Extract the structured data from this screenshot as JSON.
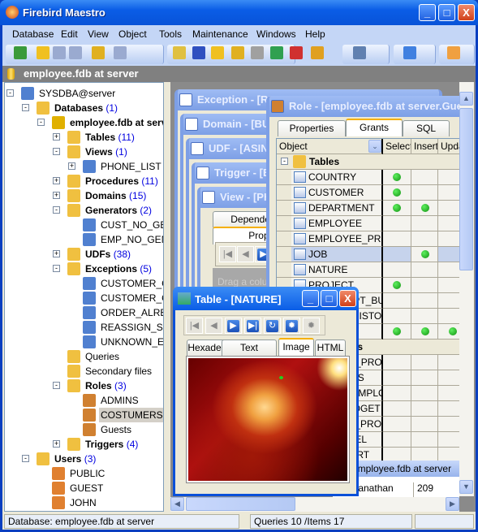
{
  "app": {
    "title": "Firebird Maestro",
    "icon": "firebird-logo-icon",
    "window_buttons": {
      "minimize": "_",
      "maximize": "□",
      "close": "X"
    }
  },
  "menu": [
    "Database",
    "Edit",
    "View",
    "Object",
    "Tools",
    "Maintenance",
    "Windows",
    "Help"
  ],
  "toolbar_icons": [
    "refresh-icon",
    "create-database-icon",
    "register-database-icon",
    "unregister-database-icon",
    "connect-icon",
    "disconnect-icon",
    "new-object-icon",
    "design-icon",
    "execute-icon",
    "backup-icon",
    "print-icon",
    "image-icon",
    "chart-icon",
    "tools-icon",
    "filter-icon",
    "windows-icon",
    "home-icon"
  ],
  "header": {
    "title": "employee.fdb at server"
  },
  "tree": [
    {
      "label": "SYSDBA@server",
      "level": 0,
      "exp": "-",
      "icon": "server-icon",
      "bold": false,
      "color": "#5080d0"
    },
    {
      "label": "Databases",
      "count": "(1)",
      "level": 1,
      "exp": "-",
      "icon": "databases-folder-icon",
      "bold": true,
      "color": "#f0c040"
    },
    {
      "label": "employee.fdb at server",
      "level": 2,
      "exp": "-",
      "icon": "database-icon",
      "bold": true,
      "color": "#e0b000"
    },
    {
      "label": "Tables",
      "count": "(11)",
      "level": 3,
      "exp": "+",
      "icon": "tables-folder-icon",
      "bold": true,
      "color": "#f0c040"
    },
    {
      "label": "Views",
      "count": "(1)",
      "level": 3,
      "exp": "-",
      "icon": "views-folder-icon",
      "bold": true,
      "color": "#f0c040"
    },
    {
      "label": "PHONE_LIST",
      "level": 4,
      "exp": "+",
      "icon": "view-icon",
      "bold": false,
      "color": "#5080d0"
    },
    {
      "label": "Procedures",
      "count": "(11)",
      "level": 3,
      "exp": "+",
      "icon": "procedures-folder-icon",
      "bold": true,
      "color": "#f0c040"
    },
    {
      "label": "Domains",
      "count": "(15)",
      "level": 3,
      "exp": "+",
      "icon": "domains-folder-icon",
      "bold": true,
      "color": "#f0c040"
    },
    {
      "label": "Generators",
      "count": "(2)",
      "level": 3,
      "exp": "-",
      "icon": "generators-folder-icon",
      "bold": true,
      "color": "#f0c040"
    },
    {
      "label": "CUST_NO_GEN",
      "level": 4,
      "icon": "generator-icon",
      "bold": false,
      "color": "#5080d0"
    },
    {
      "label": "EMP_NO_GEN [",
      "level": 4,
      "icon": "generator-icon",
      "bold": false,
      "color": "#5080d0"
    },
    {
      "label": "UDFs",
      "count": "(38)",
      "level": 3,
      "exp": "+",
      "icon": "udfs-folder-icon",
      "bold": true,
      "color": "#f0c040"
    },
    {
      "label": "Exceptions",
      "count": "(5)",
      "level": 3,
      "exp": "-",
      "icon": "exceptions-folder-icon",
      "bold": true,
      "color": "#f0c040"
    },
    {
      "label": "CUSTOMER_CHECK",
      "level": 4,
      "icon": "exception-icon",
      "bold": false,
      "color": "#5080d0"
    },
    {
      "label": "CUSTOMER_ON_HOLD",
      "level": 4,
      "icon": "exception-icon",
      "bold": false,
      "color": "#5080d0"
    },
    {
      "label": "ORDER_ALREADY_SHIPPED",
      "level": 4,
      "icon": "exception-icon",
      "bold": false,
      "color": "#5080d0"
    },
    {
      "label": "REASSIGN_SALES",
      "level": 4,
      "icon": "exception-icon",
      "bold": false,
      "color": "#5080d0"
    },
    {
      "label": "UNKNOWN_EMP_ID",
      "level": 4,
      "icon": "exception-icon",
      "bold": false,
      "color": "#5080d0"
    },
    {
      "label": "Queries",
      "level": 3,
      "icon": "queries-folder-icon",
      "bold": false,
      "color": "#f0c040"
    },
    {
      "label": "Secondary files",
      "level": 3,
      "icon": "secondary-files-folder-icon",
      "bold": false,
      "color": "#f0c040"
    },
    {
      "label": "Roles",
      "count": "(3)",
      "level": 3,
      "exp": "-",
      "icon": "roles-folder-icon",
      "bold": true,
      "color": "#f0c040"
    },
    {
      "label": "ADMINS",
      "level": 4,
      "icon": "role-icon",
      "bold": false,
      "color": "#d08030"
    },
    {
      "label": "COSTUMERS",
      "level": 4,
      "icon": "role-icon",
      "bold": false,
      "color": "#d08030",
      "selected": true
    },
    {
      "label": "Guests",
      "level": 4,
      "icon": "role-icon",
      "bold": false,
      "color": "#d08030"
    },
    {
      "label": "Triggers",
      "count": "(4)",
      "level": 3,
      "exp": "+",
      "icon": "triggers-folder-icon",
      "bold": true,
      "color": "#f0c040"
    },
    {
      "label": "Users",
      "count": "(3)",
      "level": 1,
      "exp": "-",
      "icon": "users-folder-icon",
      "bold": true,
      "color": "#f0c040"
    },
    {
      "label": "PUBLIC",
      "level": 2,
      "icon": "user-icon",
      "bold": false,
      "color": "#e08030"
    },
    {
      "label": "GUEST",
      "level": 2,
      "icon": "user-icon",
      "bold": false,
      "color": "#e08030"
    },
    {
      "label": "JOHN",
      "level": 2,
      "icon": "user-icon",
      "bold": false,
      "color": "#e08030"
    }
  ],
  "windows": {
    "stack": [
      {
        "title": "Exception - [RE",
        "icon": "exception-icon"
      },
      {
        "title": "Domain - [BU",
        "icon": "domain-icon"
      },
      {
        "title": "UDF - [ASIN]",
        "icon": "udf-icon"
      },
      {
        "title": "Trigger - [E",
        "icon": "trigger-icon"
      },
      {
        "title": "View - [PH",
        "icon": "view-icon"
      }
    ],
    "view_tabs": [
      "Dependencies",
      "Properties"
    ],
    "view_hint": "Drag a colu",
    "role": {
      "title": "Role - [employee.fdb at server.Guests]",
      "tabs": [
        "Properties",
        "Grants",
        "SQL"
      ],
      "active_tab": "Grants",
      "columns": [
        "Object",
        "Select",
        "Insert",
        "Update"
      ],
      "group": "Tables",
      "rows": [
        {
          "name": "COUNTRY",
          "grants": [
            1,
            0,
            0
          ]
        },
        {
          "name": "CUSTOMER",
          "grants": [
            1,
            0,
            0
          ]
        },
        {
          "name": "DEPARTMENT",
          "grants": [
            1,
            1,
            0
          ]
        },
        {
          "name": "EMPLOYEE",
          "grants": [
            0,
            0,
            0
          ]
        },
        {
          "name": "EMPLOYEE_PROJECT",
          "grants": [
            0,
            0,
            0
          ]
        },
        {
          "name": "JOB",
          "grants": [
            0,
            1,
            0
          ],
          "selected": true
        },
        {
          "name": "NATURE",
          "grants": [
            0,
            0,
            0
          ]
        },
        {
          "name": "PROJECT",
          "grants": [
            1,
            0,
            0
          ]
        },
        {
          "name": "PROJ_DEPT_BUDGET",
          "grants": [
            0,
            0,
            0
          ]
        },
        {
          "name": "SALARY_HISTORY",
          "grants": [
            0,
            0,
            0
          ]
        },
        {
          "name": "SALES",
          "grants": [
            1,
            1,
            1
          ]
        }
      ],
      "group2": "Procedures",
      "rows2": [
        {
          "name": "ADD_EMP_PROJ"
        },
        {
          "name": "ALL_LANGS"
        },
        {
          "name": "DELETE_EMPLOYEE"
        },
        {
          "name": "DEPT_BUDGET"
        },
        {
          "name": "GET_EMP_PROJ"
        },
        {
          "name": "MAIL_LABEL"
        },
        {
          "name": "ORG_CHART"
        }
      ]
    },
    "bottom_window": {
      "title": "employee.fdb at server",
      "cell_name": "Ramanathan",
      "cell_value": "209"
    },
    "table": {
      "title": "Table - [NATURE]",
      "nav": [
        "first-record-icon",
        "prior-record-icon",
        "next-record-icon",
        "last-record-icon",
        "refresh-icon",
        "post-icon",
        "cancel-icon"
      ],
      "tabs": [
        "Hexadecimal",
        "Text",
        "Image",
        "HTML"
      ],
      "active_tab": "Image",
      "image": "eagle-image"
    }
  },
  "status": {
    "left": "Database: employee.fdb at server",
    "middle": "Queries 10 /Items 17",
    "right": ""
  }
}
